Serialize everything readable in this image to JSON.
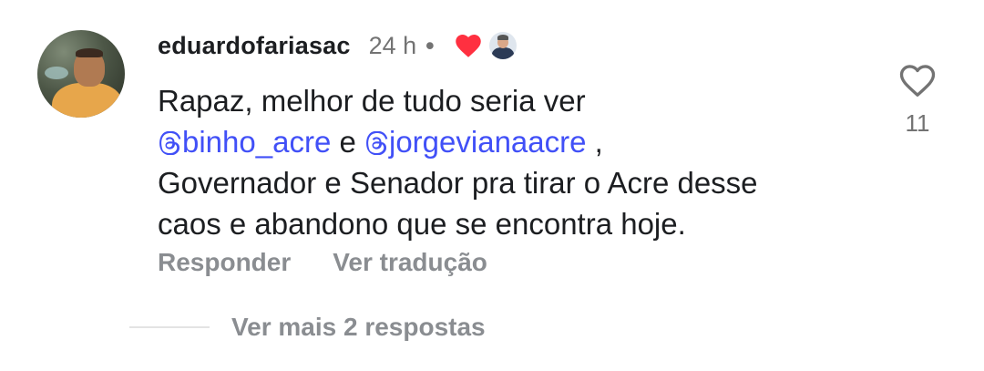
{
  "comment": {
    "username": "eduardofariasac",
    "time": "24 h",
    "separator": "•",
    "liked_by_author_icon": "heart-filled-icon",
    "author_avatar_icon": "author-avatar",
    "text": {
      "line1": "Rapaz, melhor de tudo seria ver",
      "mention1": "binho_acre",
      "connector": " e ",
      "mention2": "jorgevianaacre",
      "trailing": " ,",
      "line3": "Governador e Senador pra tirar o Acre desse",
      "line4": "caos e abandono que se encontra hoje."
    },
    "actions": {
      "reply": "Responder",
      "translate": "Ver tradução"
    },
    "view_replies": "Ver mais 2 respostas",
    "like": {
      "icon": "heart-outline-icon",
      "count": "11"
    }
  },
  "colors": {
    "mention": "#4150f7",
    "heart": "#ff3040",
    "muted": "#8a8d91",
    "text": "#1c1e21"
  }
}
